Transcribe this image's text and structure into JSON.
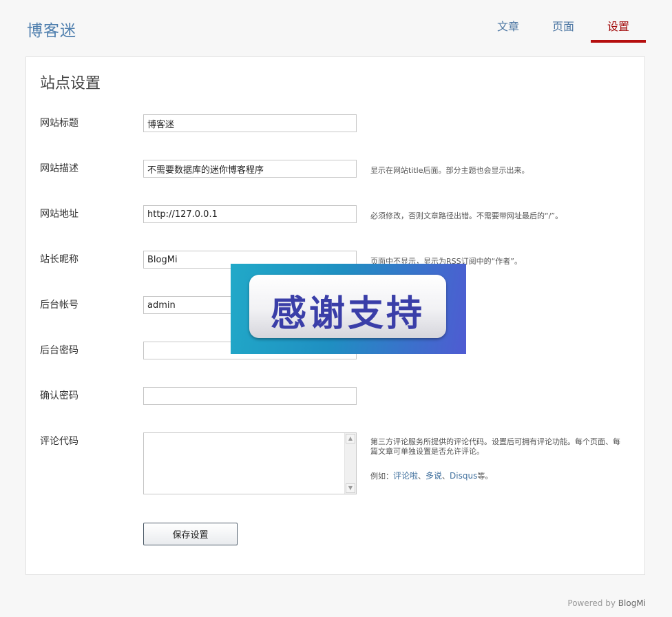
{
  "brand": "博客迷",
  "nav": [
    {
      "label": "文章"
    },
    {
      "label": "页面"
    },
    {
      "label": "设置"
    }
  ],
  "panel_title": "站点设置",
  "fields": {
    "site_title": {
      "label": "网站标题",
      "value": "博客迷"
    },
    "site_desc": {
      "label": "网站描述",
      "value": "不需要数据库的迷你博客程序",
      "hint": "显示在网站title后面。部分主题也会显示出来。"
    },
    "site_url": {
      "label": "网站地址",
      "value": "http://127.0.0.1",
      "hint": "必须修改，否则文章路径出错。不需要带网址最后的“/”。"
    },
    "nickname": {
      "label": "站长昵称",
      "value": "BlogMi",
      "hint": "页面中不显示，显示为RSS订阅中的“作者”。"
    },
    "account": {
      "label": "后台帐号",
      "value": "admin"
    },
    "password": {
      "label": "后台密码",
      "value": ""
    },
    "password_confirm": {
      "label": "确认密码",
      "value": ""
    },
    "comment_code": {
      "label": "评论代码",
      "value": "",
      "hint": "第三方评论服务所提供的评论代码。设置后可拥有评论功能。每个页面、每篇文章可单独设置是否允许评论。",
      "example_prefix": "例如：",
      "examples": [
        "评论啦",
        "多说",
        "Disqus"
      ],
      "sep": "、",
      "example_suffix": "等。"
    }
  },
  "save_label": "保存设置",
  "footer": {
    "prefix": "Powered by ",
    "brand": "BlogMi"
  },
  "overlay_text": "感谢支持"
}
